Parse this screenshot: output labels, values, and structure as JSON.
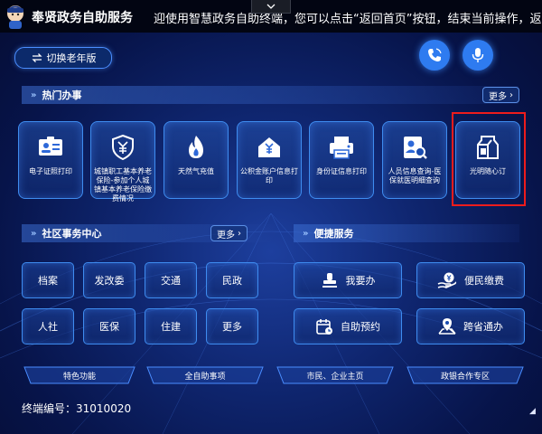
{
  "app": {
    "title": "奉贤政务自助服务"
  },
  "marquee": "迎使用智慧政务自助终端，您可以点击“返回首页”按钮，结束当前操作，返",
  "elder_mode": "切换老年版",
  "hot": {
    "title": "热门办事",
    "more": "更多",
    "items": [
      {
        "label": "电子证照打印",
        "icon": "id-card-icon"
      },
      {
        "label": "城镇职工基本养老保险-参加个人城镇基本养老保险缴费情况",
        "icon": "shield-yen-icon"
      },
      {
        "label": "天然气充值",
        "icon": "flame-icon"
      },
      {
        "label": "公积金账户信息打印",
        "icon": "house-fund-icon"
      },
      {
        "label": "身份证信息打印",
        "icon": "id-printer-icon"
      },
      {
        "label": "人员信息查询-医保就医明细查询",
        "icon": "person-search-icon"
      },
      {
        "label": "光明随心订",
        "icon": "milk-box-icon"
      }
    ]
  },
  "community": {
    "title": "社区事务中心",
    "more": "更多",
    "items": [
      "档案",
      "发改委",
      "交通",
      "民政",
      "人社",
      "医保",
      "住建",
      "更多"
    ]
  },
  "quick": {
    "title": "便捷服务",
    "items": [
      {
        "label": "我要办",
        "icon": "stamp-icon"
      },
      {
        "label": "便民缴费",
        "icon": "hand-yen-icon"
      },
      {
        "label": "自助预约",
        "icon": "calendar-icon"
      },
      {
        "label": "跨省通办",
        "icon": "location-map-icon"
      }
    ]
  },
  "tabs": [
    "特色功能",
    "全自助事项",
    "市民、企业主页",
    "政银合作专区"
  ],
  "terminal": {
    "label": "终端编号：",
    "id": "31010020"
  }
}
